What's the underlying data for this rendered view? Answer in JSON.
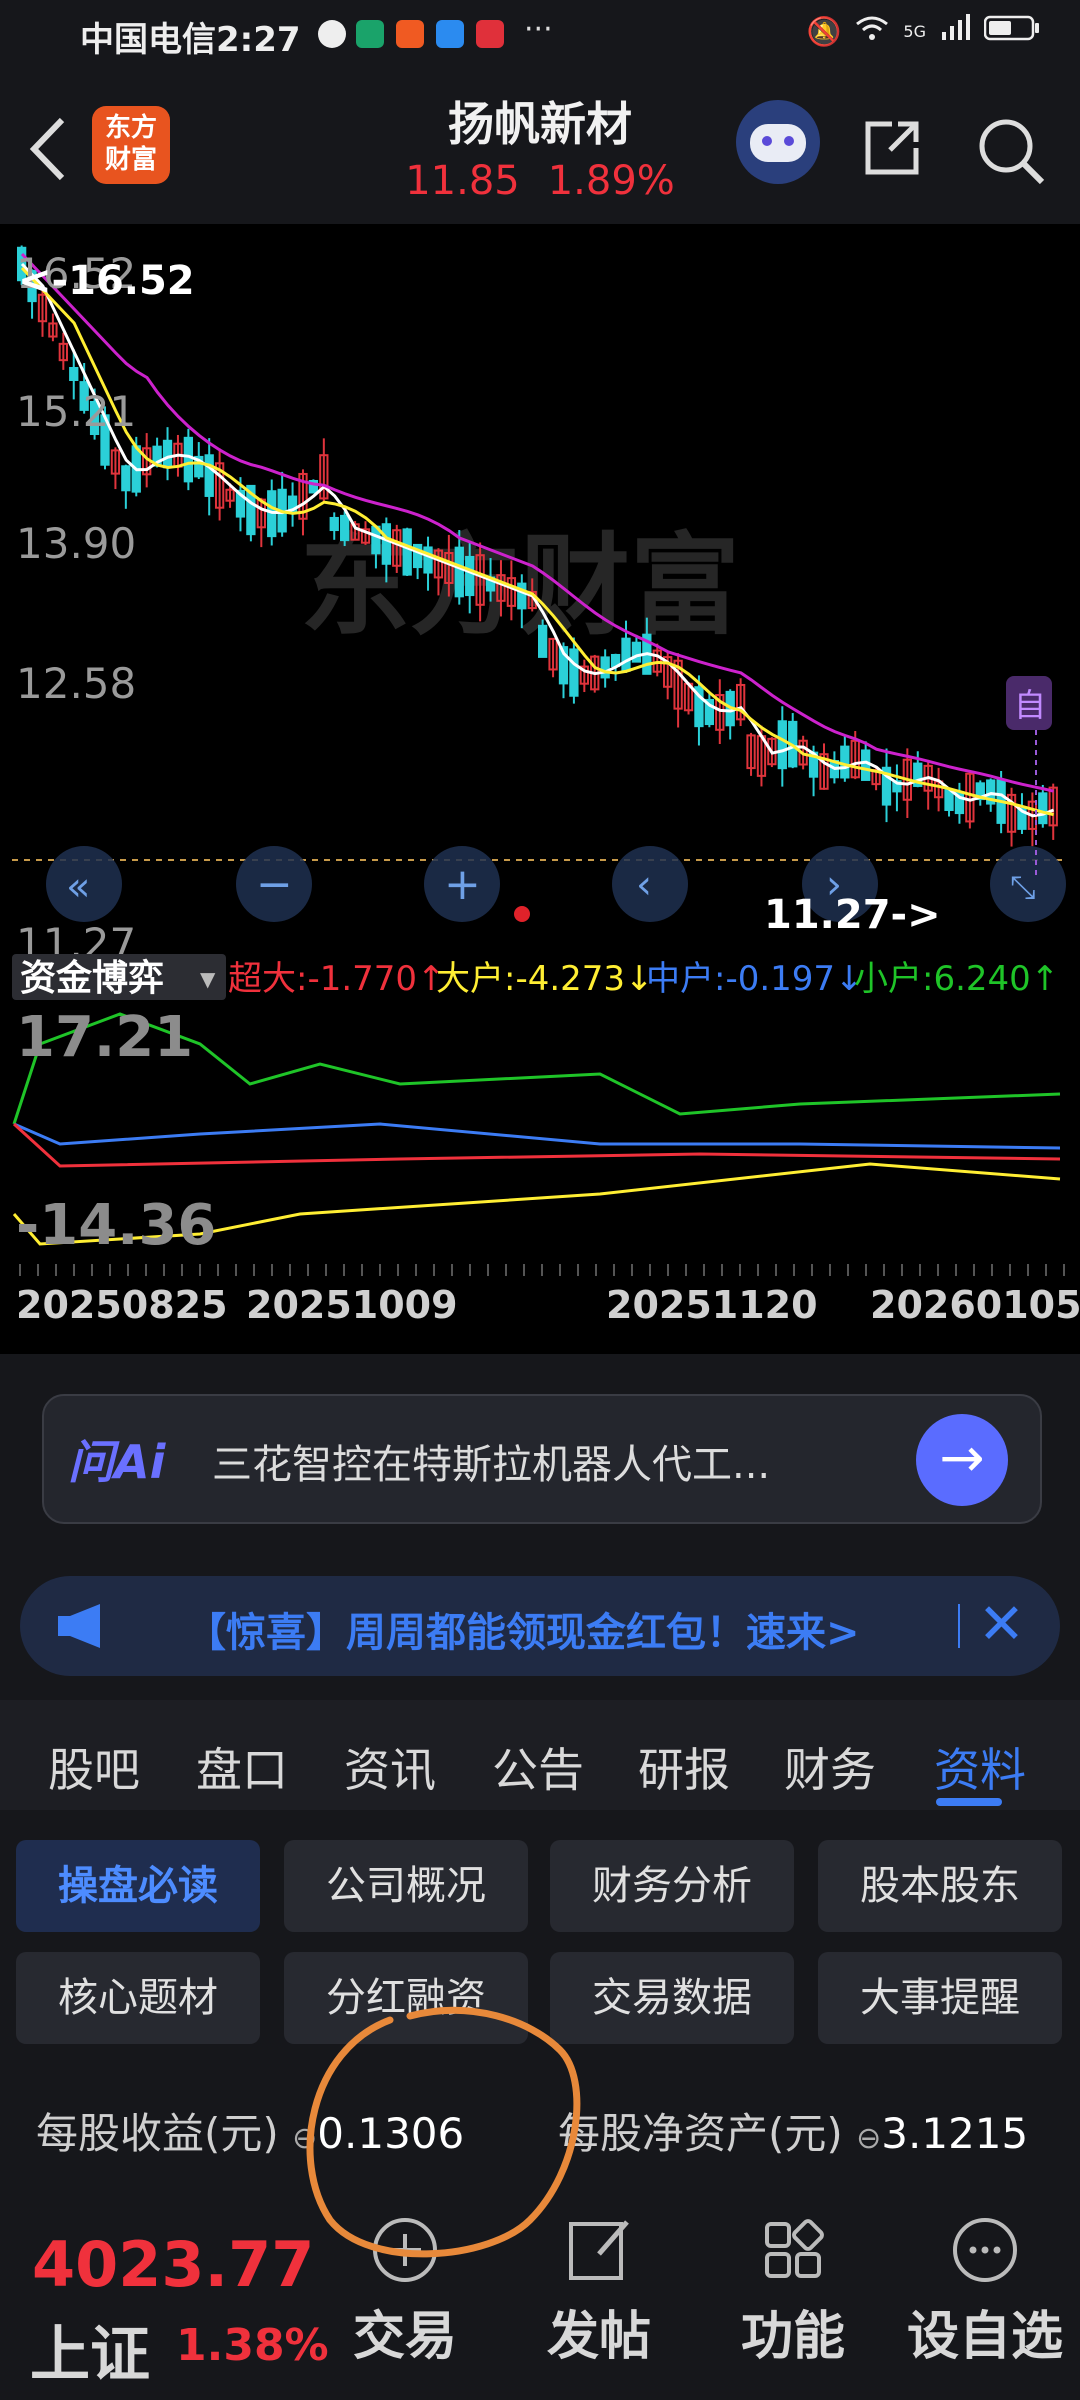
{
  "status_bar": {
    "carrier_time": "中国电信2:27",
    "extra": "···",
    "net": "5G"
  },
  "header": {
    "back_icon": "chevron-left-icon",
    "app_logo": "东方\n财富",
    "stock_name": "扬帆新材",
    "price": "11.85",
    "change_pct": "1.89%"
  },
  "chart": {
    "y_labels": [
      "16.52",
      "15.21",
      "13.90",
      "12.58",
      "11.27"
    ],
    "high_marker": "<-16.52",
    "low_marker": "11.27->",
    "watermark": "东方财富",
    "self_select_badge": "自",
    "colors": {
      "up": "#e0343c",
      "down": "#2bd0d8",
      "ma5": "#ffffff",
      "ma10": "#ffee33",
      "ma20": "#cc22cc"
    }
  },
  "fund_flow": {
    "title": "资金博弈",
    "super_large": "超大:-1.770↑",
    "large": "大户:-4.273↓",
    "medium": "中户:-0.197↓",
    "small": "小户:6.240↑",
    "y_top": "17.21",
    "y_bottom": "-14.36",
    "dates": [
      "20250825",
      "20251009",
      "20251120",
      "20260105"
    ]
  },
  "ai": {
    "logo": "问Ai",
    "text": "三花智控在特斯拉机器人代工..."
  },
  "promo": {
    "text": "【惊喜】周周都能领现金红包！速来>"
  },
  "tabs": [
    "股吧",
    "盘口",
    "资讯",
    "公告",
    "研报",
    "财务",
    "资料"
  ],
  "sub_buttons": [
    [
      "操盘必读",
      "公司概况",
      "财务分析",
      "股本股东"
    ],
    [
      "核心题材",
      "分红融资",
      "交易数据",
      "大事提醒"
    ]
  ],
  "metrics": {
    "eps_label": "每股收益(元)",
    "eps_value": "0.1306",
    "bvps_label": "每股净资产(元)",
    "bvps_value": "3.1215"
  },
  "bottom_bar": {
    "index_value": "4023.77",
    "index_name": "上证",
    "index_pct": "1.38%",
    "nav": [
      "交易",
      "发帖",
      "功能",
      "设自选"
    ]
  }
}
